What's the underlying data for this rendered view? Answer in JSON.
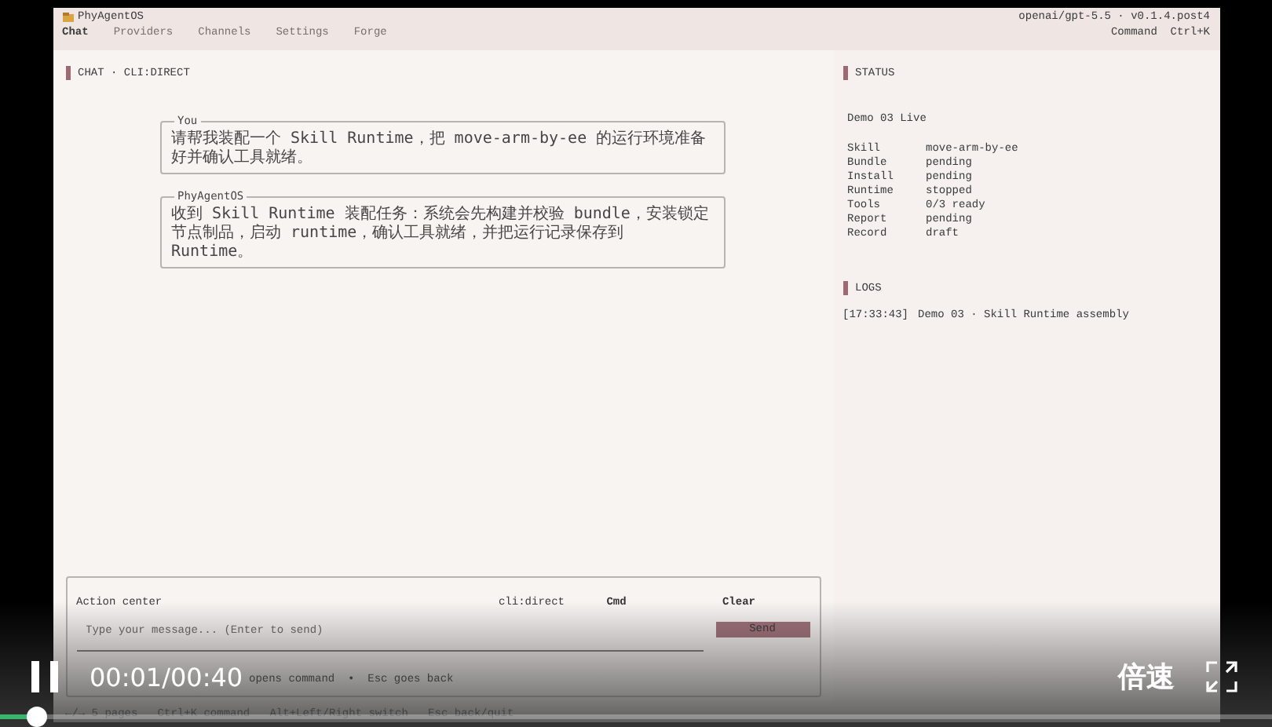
{
  "app": {
    "name": "PhyAgentOS",
    "model": "openai/gpt-5.5 · v0.1.4.post4",
    "command_hint": "Command  Ctrl+K"
  },
  "nav": [
    {
      "label": "Chat",
      "selected": true
    },
    {
      "label": "Providers",
      "selected": false
    },
    {
      "label": "Channels",
      "selected": false
    },
    {
      "label": "Settings",
      "selected": false
    },
    {
      "label": "Forge",
      "selected": false
    }
  ],
  "chat": {
    "title": "CHAT · CLI:DIRECT",
    "messages": [
      {
        "sender": "You",
        "text": "请帮我装配一个 Skill Runtime，把 move-arm-by-ee 的运行环境准备好并确认工具就绪。"
      },
      {
        "sender": "PhyAgentOS",
        "text": "收到 Skill Runtime 装配任务：系统会先构建并校验 bundle，安装锁定节点制品，启动 runtime，确认工具就绪，并把运行记录保存到 Runtime。"
      }
    ]
  },
  "status": {
    "title": "STATUS",
    "heading": "Demo 03 Live",
    "rows": [
      {
        "key": "Skill",
        "value": "move-arm-by-ee"
      },
      {
        "key": "Bundle",
        "value": "pending"
      },
      {
        "key": "Install",
        "value": "pending"
      },
      {
        "key": "Runtime",
        "value": "stopped"
      },
      {
        "key": "Tools",
        "value": "0/3 ready"
      },
      {
        "key": "Report",
        "value": "pending"
      },
      {
        "key": "Record",
        "value": "draft"
      }
    ]
  },
  "logs": {
    "title": "LOGS",
    "entries": [
      {
        "time": "[17:33:43]",
        "text": "Demo 03 · Skill Runtime assembly"
      }
    ]
  },
  "action_center": {
    "title": "Action center",
    "session": "cli:direct",
    "buttons": [
      "Cmd",
      "Clear"
    ],
    "placeholder": "Type your message... (Enter to send)",
    "send": "Send",
    "hint": "opens command  •  Esc goes back"
  },
  "status_bar": "←/→ 5 pages   Ctrl+K command   Alt+Left/Right switch   Esc back/quit",
  "player": {
    "playing": true,
    "time": "00:01/00:40",
    "speed": "倍速",
    "level": 0.03
  }
}
